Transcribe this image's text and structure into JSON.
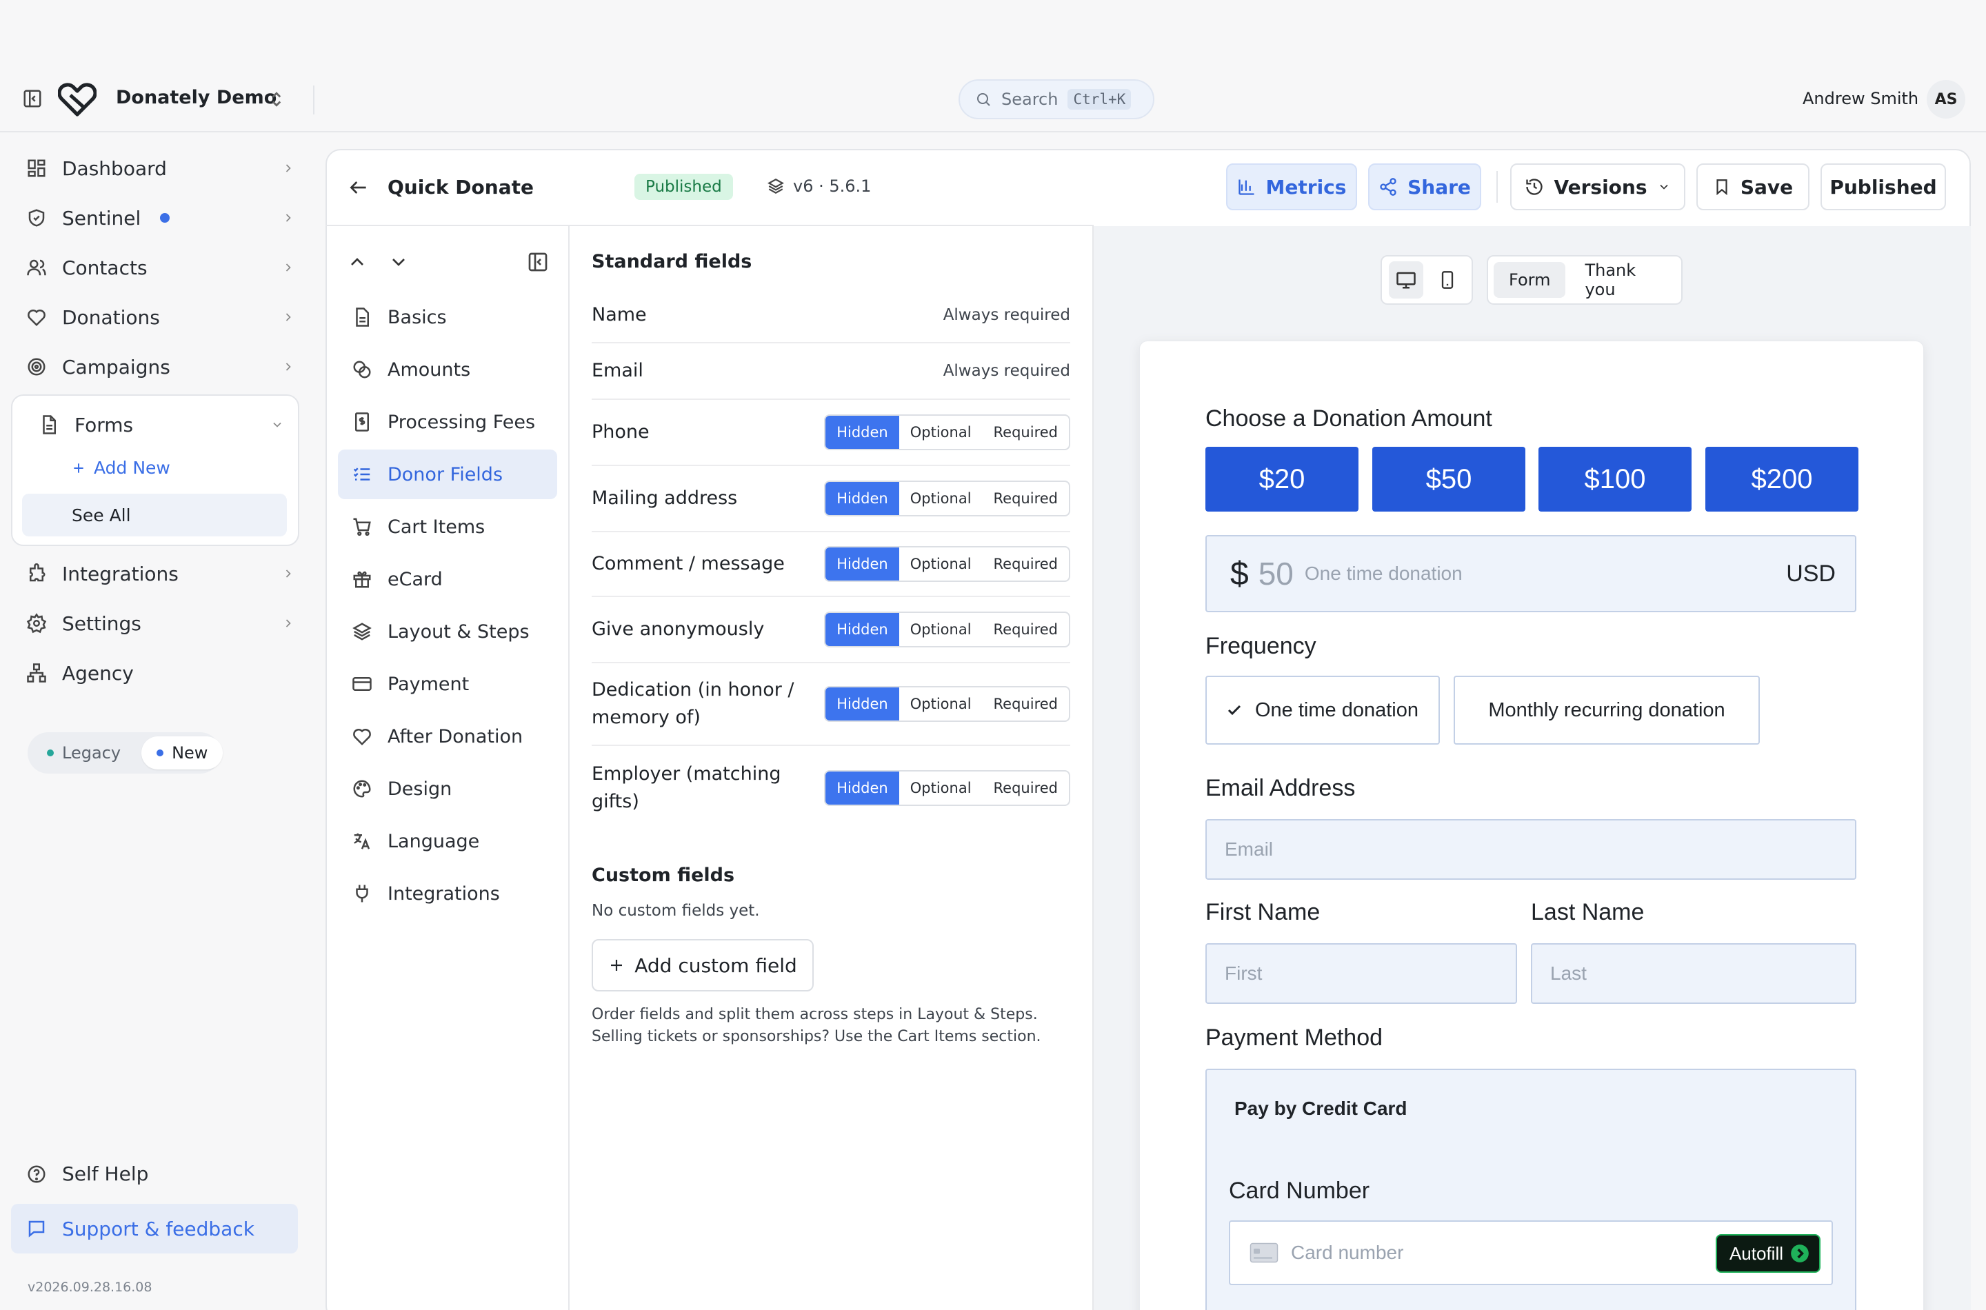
{
  "app": {
    "org_name": "Donately Demo",
    "user_name": "Andrew Smith",
    "user_initials": "AS"
  },
  "search": {
    "label": "Search",
    "shortcut": "Ctrl+K"
  },
  "sidebar": {
    "items": [
      {
        "label": "Dashboard"
      },
      {
        "label": "Sentinel"
      },
      {
        "label": "Contacts"
      },
      {
        "label": "Donations"
      },
      {
        "label": "Campaigns"
      }
    ],
    "forms": {
      "label": "Forms",
      "add_new": "Add New",
      "see_all": "See All"
    },
    "items_bottom": [
      {
        "label": "Integrations"
      },
      {
        "label": "Settings"
      },
      {
        "label": "Agency"
      }
    ],
    "toggle": {
      "legacy": "Legacy",
      "new": "New"
    },
    "self_help": "Self Help",
    "support": "Support & feedback",
    "version": "v2026.09.28.16.08"
  },
  "header": {
    "title": "Quick Donate",
    "status": "Published",
    "version": "v6 · 5.6.1",
    "metrics": "Metrics",
    "share": "Share",
    "versions": "Versions",
    "save": "Save",
    "published": "Published"
  },
  "sections": [
    {
      "label": "Basics"
    },
    {
      "label": "Amounts"
    },
    {
      "label": "Processing Fees"
    },
    {
      "label": "Donor Fields"
    },
    {
      "label": "Cart Items"
    },
    {
      "label": "eCard"
    },
    {
      "label": "Layout & Steps"
    },
    {
      "label": "Payment"
    },
    {
      "label": "After Donation"
    },
    {
      "label": "Design"
    },
    {
      "label": "Language"
    },
    {
      "label": "Integrations"
    }
  ],
  "donor_fields": {
    "standard_title": "Standard fields",
    "always_required": "Always required",
    "options": [
      "Hidden",
      "Optional",
      "Required"
    ],
    "fields": [
      {
        "label": "Name"
      },
      {
        "label": "Email"
      },
      {
        "label": "Phone",
        "selected": "Hidden"
      },
      {
        "label": "Mailing address",
        "selected": "Hidden"
      },
      {
        "label": "Comment / message",
        "selected": "Hidden"
      },
      {
        "label": "Give anonymously",
        "selected": "Hidden"
      },
      {
        "label": "Dedication (in honor / memory of)",
        "selected": "Hidden"
      },
      {
        "label": "Employer (matching gifts)",
        "selected": "Hidden"
      }
    ],
    "custom_title": "Custom fields",
    "custom_empty": "No custom fields yet.",
    "add_custom": "Add custom field",
    "hint": "Order fields and split them across steps in Layout & Steps. Selling tickets or sponsorships? Use the Cart Items section."
  },
  "preview": {
    "mode_form": "Form",
    "mode_thankyou": "Thank you",
    "choose_amount": "Choose a Donation Amount",
    "amounts": [
      "$20",
      "$50",
      "$100",
      "$200"
    ],
    "currency_symbol": "$",
    "amount_value": "50",
    "amount_subtitle": "One time donation",
    "currency_code": "USD",
    "frequency_label": "Frequency",
    "freq_one_time": "One time donation",
    "freq_monthly": "Monthly recurring donation",
    "email_label": "Email Address",
    "email_placeholder": "Email",
    "first_label": "First Name",
    "first_placeholder": "First",
    "last_label": "Last Name",
    "last_placeholder": "Last",
    "payment_label": "Payment Method",
    "pay_title": "Pay by Credit Card",
    "card_label": "Card Number",
    "card_placeholder": "Card number",
    "autofill": "Autofill"
  }
}
